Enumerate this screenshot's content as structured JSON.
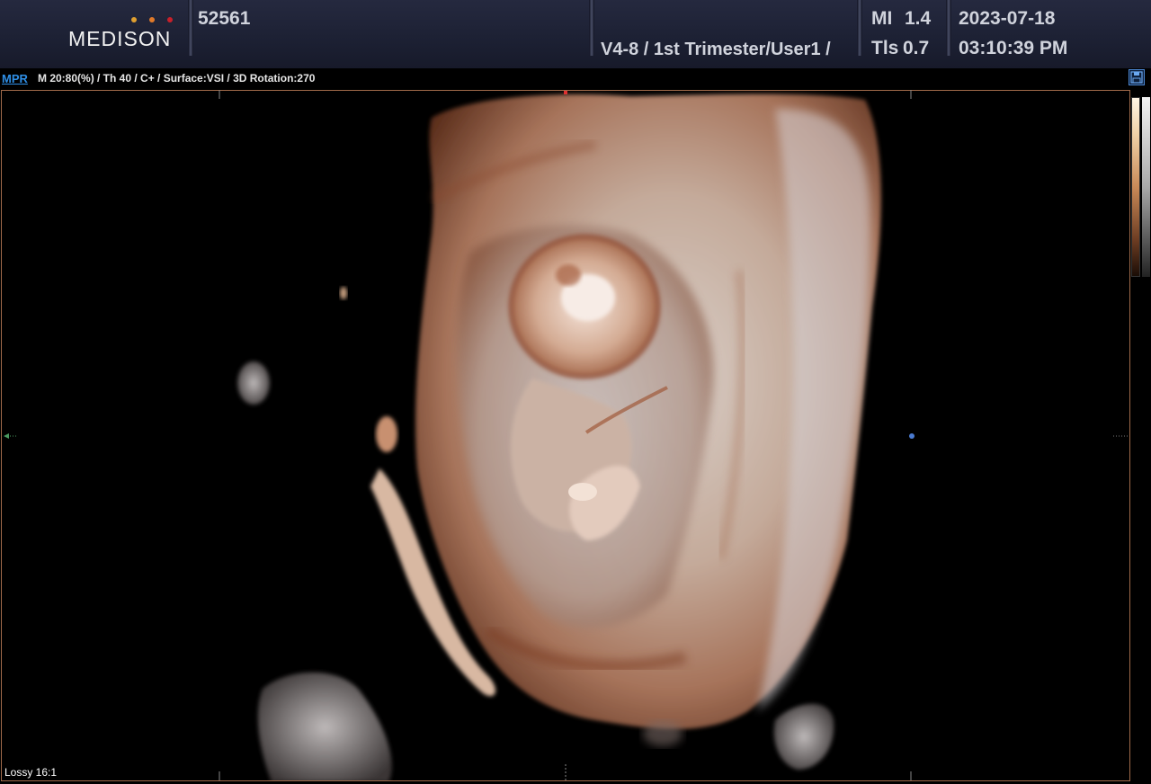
{
  "header": {
    "logo": "MEDISON",
    "patient_id": "52561",
    "preset": "V4-8 / 1st Trimester/User1 /",
    "mi_label": "MI",
    "mi_value": "1.4",
    "tis_label": "Tls",
    "tis_value": "0.7",
    "date": "2023-07-18",
    "time": "03:10:39 PM"
  },
  "info": {
    "mode": "MPR",
    "params": "M 20:80(%) / Th 40 / C+ / Surface:VSI / 3D Rotation:270"
  },
  "viewport": {
    "compression": "Lossy 16:1"
  },
  "colors": {
    "header_bg": "#1c2033",
    "mode_accent": "#2f8fe6",
    "viewport_border": "#a06a4a",
    "logo_dot_1": "#e0a030",
    "logo_dot_2": "#e07a2a",
    "logo_dot_3": "#c8202a"
  },
  "icons": {
    "save": "save-icon",
    "colorbar": "grayscale-colorbar"
  }
}
